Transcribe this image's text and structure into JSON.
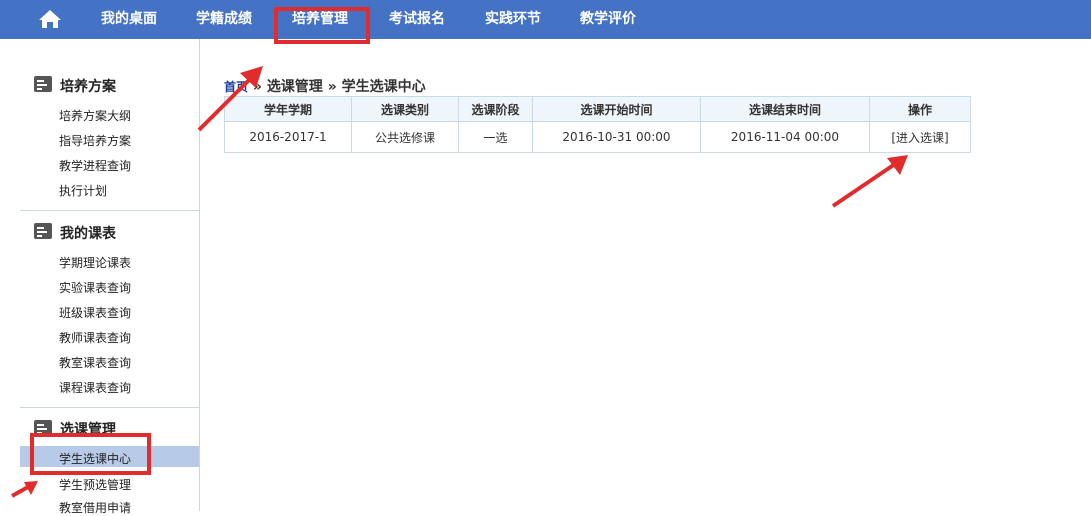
{
  "nav": {
    "items": [
      {
        "label": "我的桌面"
      },
      {
        "label": "学籍成绩"
      },
      {
        "label": "培养管理"
      },
      {
        "label": "考试报名"
      },
      {
        "label": "实践环节"
      },
      {
        "label": "教学评价"
      }
    ],
    "home_icon": "home-icon",
    "active": "培养管理"
  },
  "sidebar": {
    "sections": [
      {
        "title": "培养方案",
        "icon": "section-list-icon",
        "items": [
          "培养方案大纲",
          "指导培养方案",
          "教学进程查询",
          "执行计划"
        ]
      },
      {
        "title": "我的课表",
        "icon": "section-list-icon",
        "items": [
          "学期理论课表",
          "实验课表查询",
          "班级课表查询",
          "教师课表查询",
          "教室课表查询",
          "课程课表查询"
        ]
      },
      {
        "title": "选课管理",
        "icon": "section-list-icon",
        "items": [
          "学生选课中心",
          "学生预选管理",
          "教室借用申请"
        ]
      }
    ],
    "active_item": "学生选课中心"
  },
  "breadcrumb": {
    "home": "首页",
    "sep1": "»",
    "level1": "选课管理",
    "sep2": "»",
    "level2": "学生选课中心"
  },
  "table": {
    "headers": [
      "学年学期",
      "选课类别",
      "选课阶段",
      "选课开始时间",
      "选课结束时间",
      "操作"
    ],
    "rows": [
      [
        "2016-2017-1",
        "公共选修课",
        "一选",
        "2016-10-31 00:00",
        "2016-11-04 00:00",
        "[进入选课]"
      ]
    ]
  },
  "annotations": {
    "color": "#e02c2c"
  }
}
